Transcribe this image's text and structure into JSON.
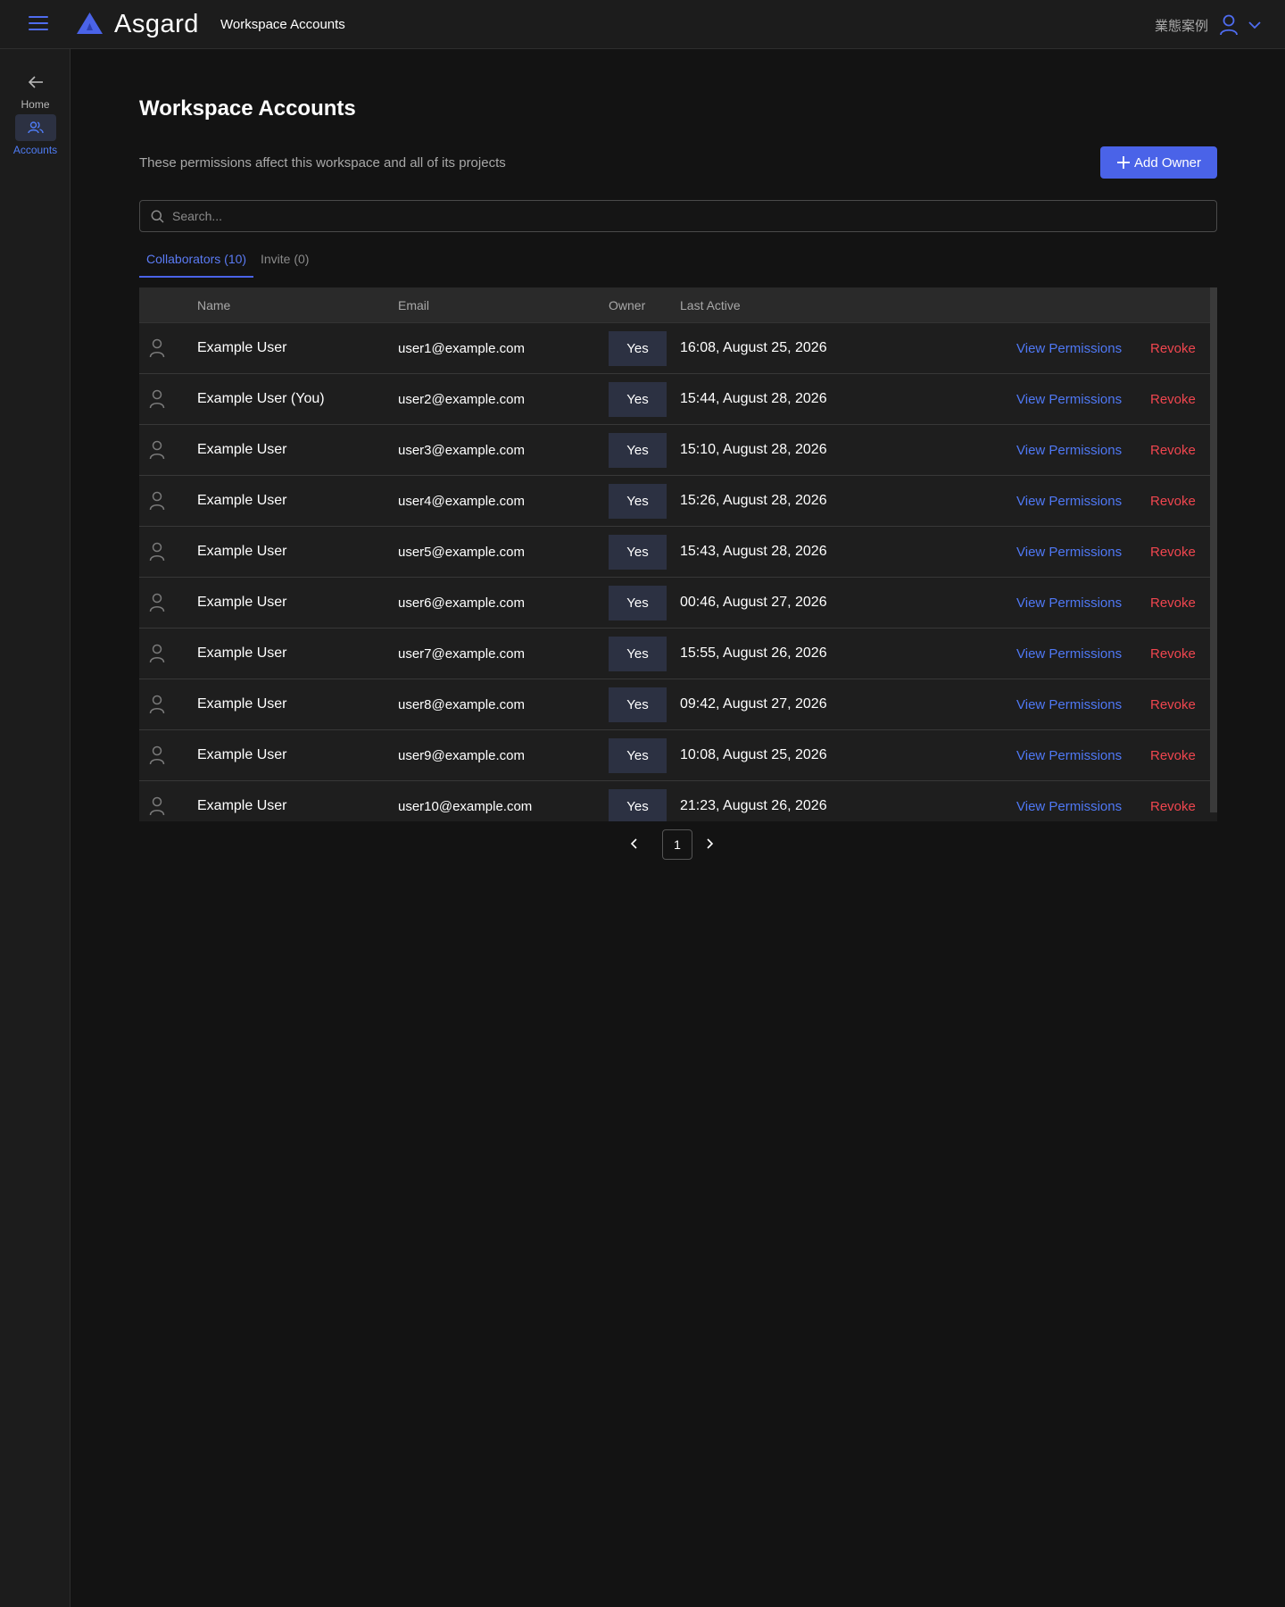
{
  "app": {
    "name": "Asgard",
    "page_crumb": "Workspace Accounts",
    "language_label": "業態案例"
  },
  "colors": {
    "accent": "#4a63e8",
    "link": "#4f78f5",
    "danger": "#f0464f",
    "background": "#131313"
  },
  "sidebar": {
    "items": [
      {
        "label": "Home",
        "icon": "arrow-left-icon"
      },
      {
        "label": "Accounts",
        "icon": "users-icon",
        "active": true
      }
    ]
  },
  "header": {
    "title": "Workspace Accounts",
    "subtitle": "These permissions affect this workspace and all of its projects",
    "add_owner_label": "Add Owner"
  },
  "search": {
    "placeholder": "Search..."
  },
  "tabs": [
    {
      "label": "Collaborators (10)",
      "active": true
    },
    {
      "label": "Invite (0)",
      "active": false
    }
  ],
  "table": {
    "columns": [
      "Name",
      "Email",
      "Owner",
      "Last Active"
    ],
    "view_label": "View Permissions",
    "revoke_label": "Revoke",
    "rows": [
      {
        "name": "Example User",
        "email": "user1@example.com",
        "owner": "Yes",
        "last_active": "16:08, August 25, 2026"
      },
      {
        "name": "Example User (You)",
        "email": "user2@example.com",
        "owner": "Yes",
        "last_active": "15:44, August 28, 2026"
      },
      {
        "name": "Example User",
        "email": "user3@example.com",
        "owner": "Yes",
        "last_active": "15:10, August 28, 2026"
      },
      {
        "name": "Example User",
        "email": "user4@example.com",
        "owner": "Yes",
        "last_active": "15:26, August 28, 2026"
      },
      {
        "name": "Example User",
        "email": "user5@example.com",
        "owner": "Yes",
        "last_active": "15:43, August 28, 2026"
      },
      {
        "name": "Example User",
        "email": "user6@example.com",
        "owner": "Yes",
        "last_active": "00:46, August 27, 2026"
      },
      {
        "name": "Example User",
        "email": "user7@example.com",
        "owner": "Yes",
        "last_active": "15:55, August 26, 2026"
      },
      {
        "name": "Example User",
        "email": "user8@example.com",
        "owner": "Yes",
        "last_active": "09:42, August 27, 2026"
      },
      {
        "name": "Example User",
        "email": "user9@example.com",
        "owner": "Yes",
        "last_active": "10:08, August 25, 2026"
      },
      {
        "name": "Example User",
        "email": "user10@example.com",
        "owner": "Yes",
        "last_active": "21:23, August 26, 2026"
      }
    ]
  },
  "pagination": {
    "current_page": "1"
  }
}
